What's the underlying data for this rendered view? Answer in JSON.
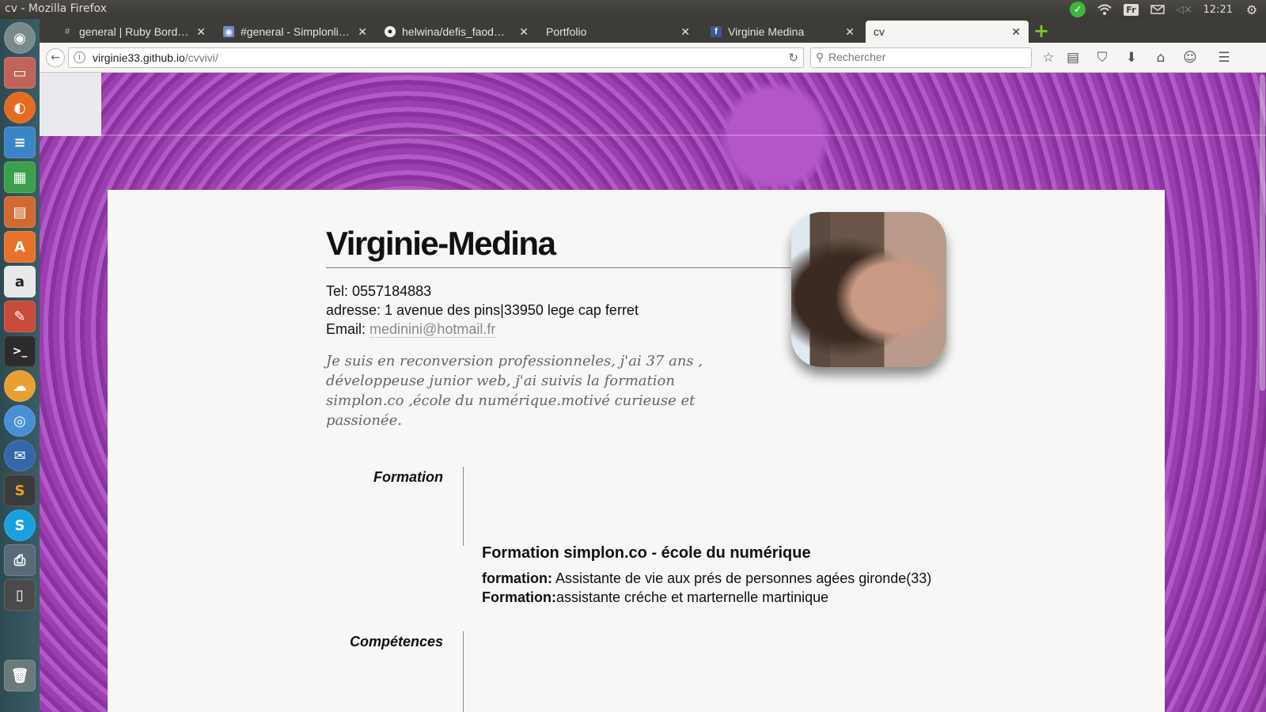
{
  "window": {
    "title": "cv - Mozilla Firefox"
  },
  "system_tray": {
    "keyboard_layout": "Fr",
    "time": "12:21"
  },
  "launcher": {
    "items": [
      "files",
      "firefox",
      "writer",
      "calc",
      "impress",
      "software-center",
      "amazon",
      "system-settings",
      "terminal",
      "ubuntu-one",
      "chromium",
      "thunderbird",
      "sublime-text",
      "skype",
      "printer",
      "phone",
      "trash"
    ]
  },
  "tabs": [
    {
      "label": "general | Ruby Bord…",
      "icon": "hash-icon"
    },
    {
      "label": "#general - Simplonli…",
      "icon": "discord-icon"
    },
    {
      "label": "helwina/defis_faod…",
      "icon": "github-icon"
    },
    {
      "label": "Portfolio",
      "icon": ""
    },
    {
      "label": "Virginie Medina",
      "icon": "facebook-icon"
    },
    {
      "label": "cv",
      "icon": ""
    }
  ],
  "navbar": {
    "url_host": "virginie33.github.io",
    "url_path": "/cvvivi/",
    "search_placeholder": "Rechercher"
  },
  "cv": {
    "name": "Virginie-Medina",
    "tel": "Tel: 0557184883",
    "address": "adresse: 1 avenue des pins|33950 lege cap ferret",
    "email_label": "Email: ",
    "email": "medinini@hotmail.fr",
    "bio": "Je suis en reconversion professionneles, j'ai 37 ans , développeuse junior web, j'ai suivis la formation simplon.co ,école du numérique.motivé curieuse et passionée.",
    "sections": {
      "formation_title": "Formation",
      "competences_title": "Compétences"
    },
    "formation": {
      "heading": "Formation simplon.co - école du numérique",
      "line1_label": "formation:",
      "line1_text": " Assistante de vie aux prés de personnes agées gironde(33)",
      "line2_label": "Formation:",
      "line2_text": "assistante créche et marternelle martinique"
    }
  },
  "colors": {
    "accent_purple": "#9b45b1",
    "launcher_bg": "#2e4a52"
  }
}
